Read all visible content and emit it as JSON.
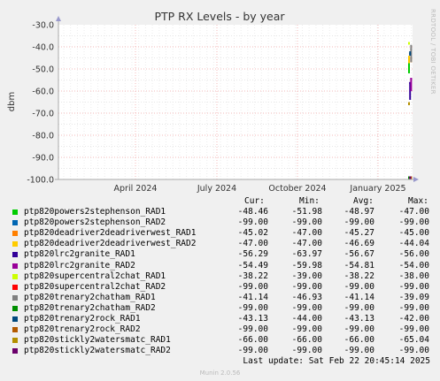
{
  "chart_data": {
    "type": "line",
    "title": "PTP RX Levels - by year",
    "ylabel": "dbm",
    "ylim": [
      -100,
      -30
    ],
    "yticks": [
      "-30.0",
      "-40.0",
      "-50.0",
      "-60.0",
      "-70.0",
      "-80.0",
      "-90.0",
      "-100.0"
    ],
    "xticks": [
      "April 2024",
      "July 2024",
      "October 2024",
      "January 2025"
    ],
    "grid": true,
    "legend_headers": [
      "Cur:",
      "Min:",
      "Avg:",
      "Max:"
    ],
    "series": [
      {
        "name": "ptp820powers2stephenson_RAD1",
        "color": "#00cc00",
        "values": [
          "-48.46",
          "-51.98",
          "-48.97",
          "-47.00"
        ]
      },
      {
        "name": "ptp820powers2stephenson_RAD2",
        "color": "#0066b3",
        "values": [
          "-99.00",
          "-99.00",
          "-99.00",
          "-99.00"
        ]
      },
      {
        "name": "ptp820deadriver2deadriverwest_RAD1",
        "color": "#ff8000",
        "values": [
          "-45.02",
          "-47.00",
          "-45.27",
          "-45.00"
        ]
      },
      {
        "name": "ptp820deadriver2deadriverwest_RAD2",
        "color": "#ffcc00",
        "values": [
          "-47.00",
          "-47.00",
          "-46.69",
          "-44.04"
        ]
      },
      {
        "name": "ptp820lrc2granite_RAD1",
        "color": "#330099",
        "values": [
          "-56.29",
          "-63.97",
          "-56.67",
          "-56.00"
        ]
      },
      {
        "name": "ptp820lrc2granite_RAD2",
        "color": "#990099",
        "values": [
          "-54.49",
          "-59.98",
          "-54.81",
          "-54.00"
        ]
      },
      {
        "name": "ptp820supercentral2chat_RAD1",
        "color": "#ccff00",
        "values": [
          "-38.22",
          "-39.00",
          "-38.22",
          "-38.00"
        ]
      },
      {
        "name": "ptp820supercentral2chat_RAD2",
        "color": "#ff0000",
        "values": [
          "-99.00",
          "-99.00",
          "-99.00",
          "-99.00"
        ]
      },
      {
        "name": "ptp820trenary2chatham_RAD1",
        "color": "#808080",
        "values": [
          "-41.14",
          "-46.93",
          "-41.14",
          "-39.09"
        ]
      },
      {
        "name": "ptp820trenary2chatham_RAD2",
        "color": "#008f00",
        "values": [
          "-99.00",
          "-99.00",
          "-99.00",
          "-99.00"
        ]
      },
      {
        "name": "ptp820trenary2rock_RAD1",
        "color": "#00487d",
        "values": [
          "-43.13",
          "-44.00",
          "-43.13",
          "-42.00"
        ]
      },
      {
        "name": "ptp820trenary2rock_RAD2",
        "color": "#b35a00",
        "values": [
          "-99.00",
          "-99.00",
          "-99.00",
          "-99.00"
        ]
      },
      {
        "name": "ptp820stickly2watersmatc_RAD1",
        "color": "#b38f00",
        "values": [
          "-66.00",
          "-66.00",
          "-66.00",
          "-65.04"
        ]
      },
      {
        "name": "ptp820stickly2watersmatc_RAD2",
        "color": "#6b006b",
        "values": [
          "-99.00",
          "-99.00",
          "-99.00",
          "-99.00"
        ]
      }
    ]
  },
  "last_update": "Last update: Sat Feb 22 20:45:14 2025",
  "munin_version": "Munin 2.0.56",
  "side_label": "RRDTOOL / TOBI OETIKER"
}
